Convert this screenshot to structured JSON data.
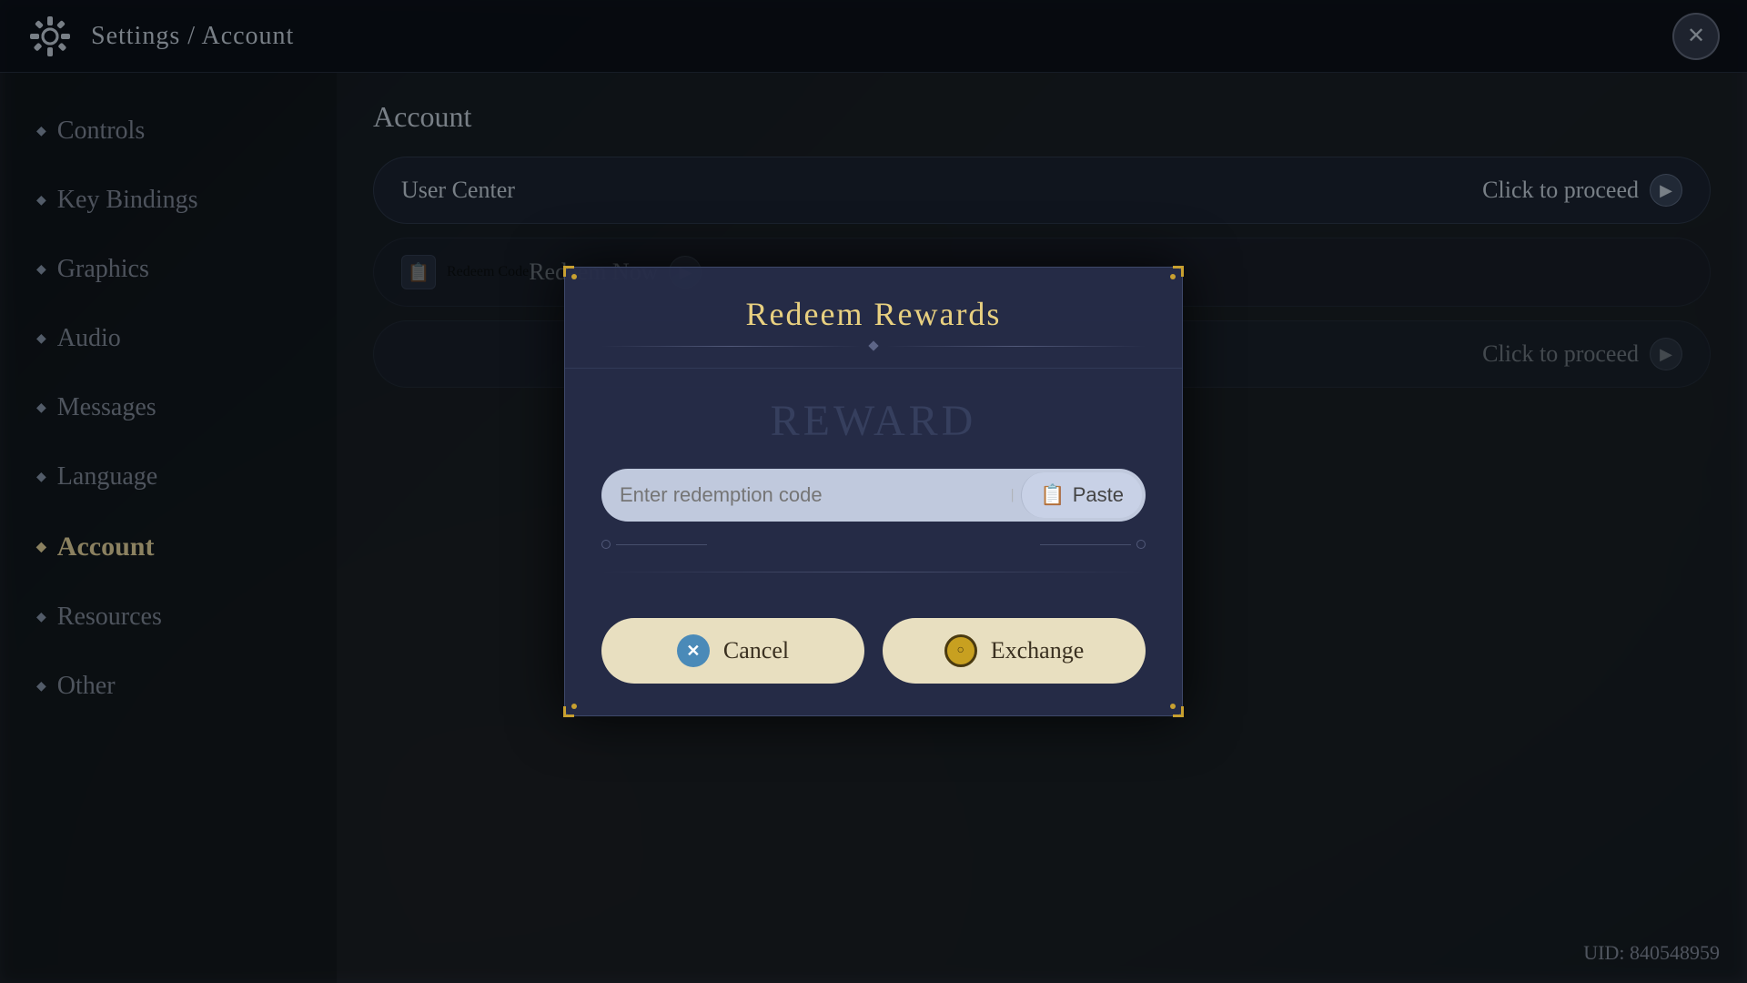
{
  "header": {
    "title": "Settings / Account",
    "close_label": "✕"
  },
  "sidebar": {
    "items": [
      {
        "id": "controls",
        "label": "Controls",
        "active": false
      },
      {
        "id": "key-bindings",
        "label": "Key Bindings",
        "active": false
      },
      {
        "id": "graphics",
        "label": "Graphics",
        "active": false
      },
      {
        "id": "audio",
        "label": "Audio",
        "active": false
      },
      {
        "id": "messages",
        "label": "Messages",
        "active": false
      },
      {
        "id": "language",
        "label": "Language",
        "active": false
      },
      {
        "id": "account",
        "label": "Account",
        "active": true
      },
      {
        "id": "resources",
        "label": "Resources",
        "active": false
      },
      {
        "id": "other",
        "label": "Other",
        "active": false
      }
    ]
  },
  "main": {
    "section_title": "Account",
    "rows": [
      {
        "id": "user-center",
        "label": "User Center",
        "action": "Click to proceed"
      },
      {
        "id": "redeem-code",
        "label": "Redeem Code",
        "action": "Redeem Now"
      },
      {
        "id": "row3",
        "label": "",
        "action": "Click to proceed"
      }
    ]
  },
  "uid": {
    "label": "UID: 840548959"
  },
  "modal": {
    "title": "Redeem Rewards",
    "ghost_text": "REWARD",
    "input": {
      "placeholder": "Enter redemption code",
      "value": ""
    },
    "paste_label": "Paste",
    "cancel_label": "Cancel",
    "exchange_label": "Exchange"
  }
}
